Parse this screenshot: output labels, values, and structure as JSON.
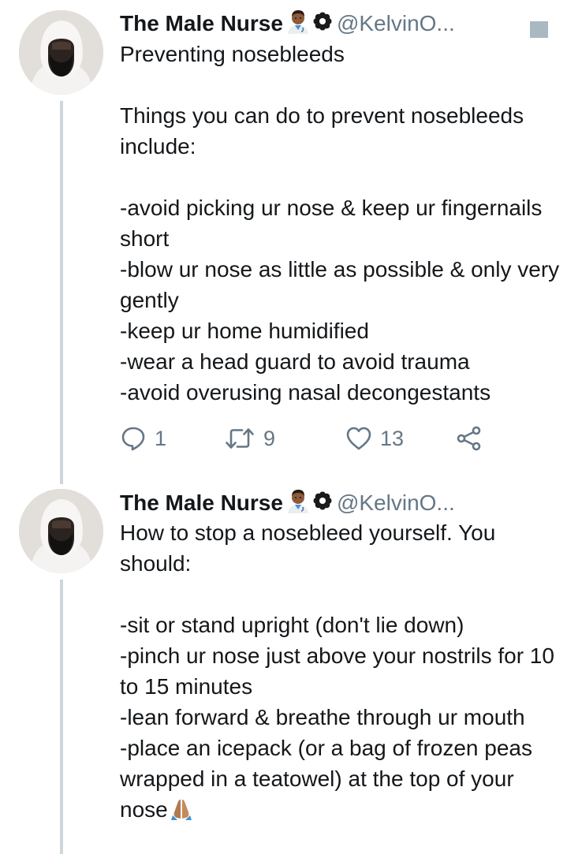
{
  "thread": [
    {
      "author": {
        "name": "The Male Nurse",
        "handle": "@KelvinO...",
        "name_emoji": "man-health-worker-emoji",
        "badge_icon": "flower-badge-icon",
        "avatar": "person-in-white-hood-avatar"
      },
      "text": "Preventing nosebleeds\n\nThings you can do to prevent nosebleeds include:\n\n-avoid picking ur nose & keep ur fingernails short\n-blow ur nose as little as possible & only very gently\n-keep ur home humidified\n-wear a head guard to avoid trauma\n-avoid overusing nasal decongestants",
      "actions": {
        "reply_count": "1",
        "retweet_count": "9",
        "like_count": "13",
        "reply_icon": "reply-icon",
        "retweet_icon": "retweet-icon",
        "like_icon": "heart-icon",
        "share_icon": "share-icon"
      },
      "menu_icon": "caret-menu-icon"
    },
    {
      "author": {
        "name": "The Male Nurse",
        "handle": "@KelvinO...",
        "name_emoji": "man-health-worker-emoji",
        "badge_icon": "flower-badge-icon",
        "avatar": "person-in-white-hood-avatar"
      },
      "text": "How to stop a nosebleed yourself. You should:\n\n-sit or stand upright (don't lie down)\n-pinch ur nose just above your nostrils for 10 to 15 minutes\n-lean forward & breathe through ur mouth\n-place an icepack (or a bag of frozen peas wrapped in a teatowel) at the top of your nose",
      "trailing_emoji": "folded-hands-emoji"
    }
  ],
  "colors": {
    "text": "#14171a",
    "secondary": "#657786",
    "thread_line": "#ccd6dd",
    "menu_caret": "#aab8c2"
  }
}
